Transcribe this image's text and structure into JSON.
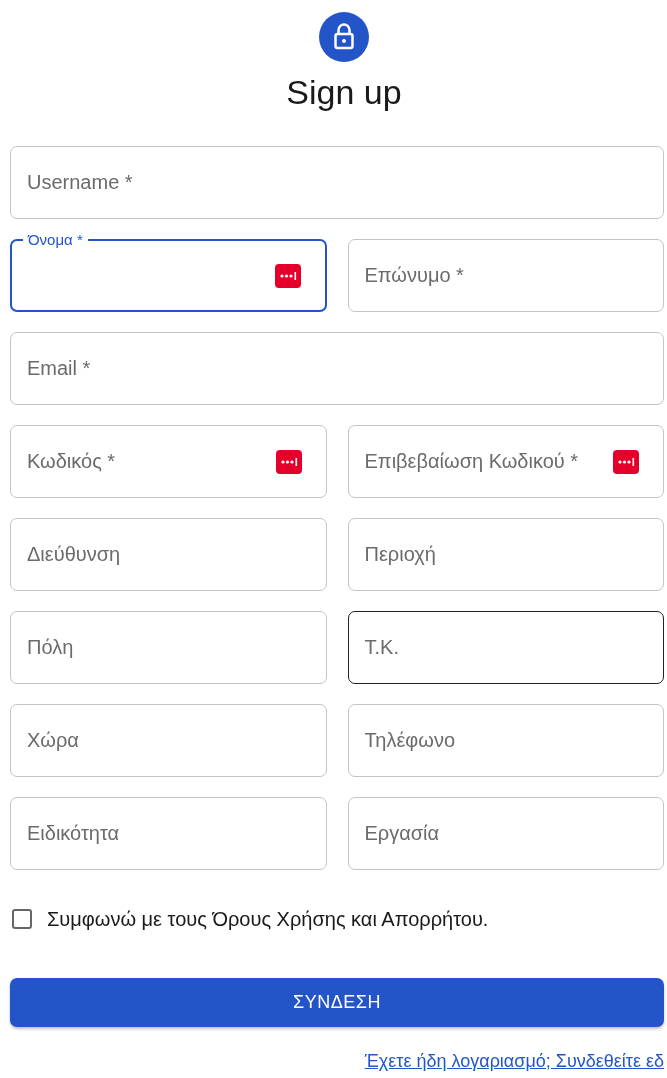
{
  "title": "Sign up",
  "rows": [
    [
      {
        "label": "Username *",
        "focused": false,
        "hovered": false,
        "pw_icon": false
      }
    ],
    [
      {
        "label": "Όνομα *",
        "focused": true,
        "hovered": false,
        "pw_icon": true
      },
      {
        "label": "Επώνυμο *",
        "focused": false,
        "hovered": false,
        "pw_icon": false
      }
    ],
    [
      {
        "label": "Email *",
        "focused": false,
        "hovered": false,
        "pw_icon": false
      }
    ],
    [
      {
        "label": "Κωδικός *",
        "focused": false,
        "hovered": false,
        "pw_icon": true
      },
      {
        "label": "Επιβεβαίωση Κωδικού *",
        "focused": false,
        "hovered": false,
        "pw_icon": true
      }
    ],
    [
      {
        "label": "Διεύθυνση",
        "focused": false,
        "hovered": false,
        "pw_icon": false
      },
      {
        "label": "Περιοχή",
        "focused": false,
        "hovered": false,
        "pw_icon": false
      }
    ],
    [
      {
        "label": "Πόλη",
        "focused": false,
        "hovered": false,
        "pw_icon": false
      },
      {
        "label": "Τ.Κ.",
        "focused": false,
        "hovered": true,
        "pw_icon": false
      }
    ],
    [
      {
        "label": "Χώρα",
        "focused": false,
        "hovered": false,
        "pw_icon": false
      },
      {
        "label": "Τηλέφωνο",
        "focused": false,
        "hovered": false,
        "pw_icon": false
      }
    ],
    [
      {
        "label": "Ειδικότητα",
        "focused": false,
        "hovered": false,
        "pw_icon": false
      },
      {
        "label": "Εργασία",
        "focused": false,
        "hovered": false,
        "pw_icon": false
      }
    ]
  ],
  "terms": {
    "label": "Συμφωνώ με τους Όρους Χρήσης και Απορρήτου.",
    "checked": false
  },
  "submit": "ΣΥΝΔΕΣΗ",
  "login_link": "Έχετε ήδη λογαριασμό; Συνδεθείτε εδ"
}
